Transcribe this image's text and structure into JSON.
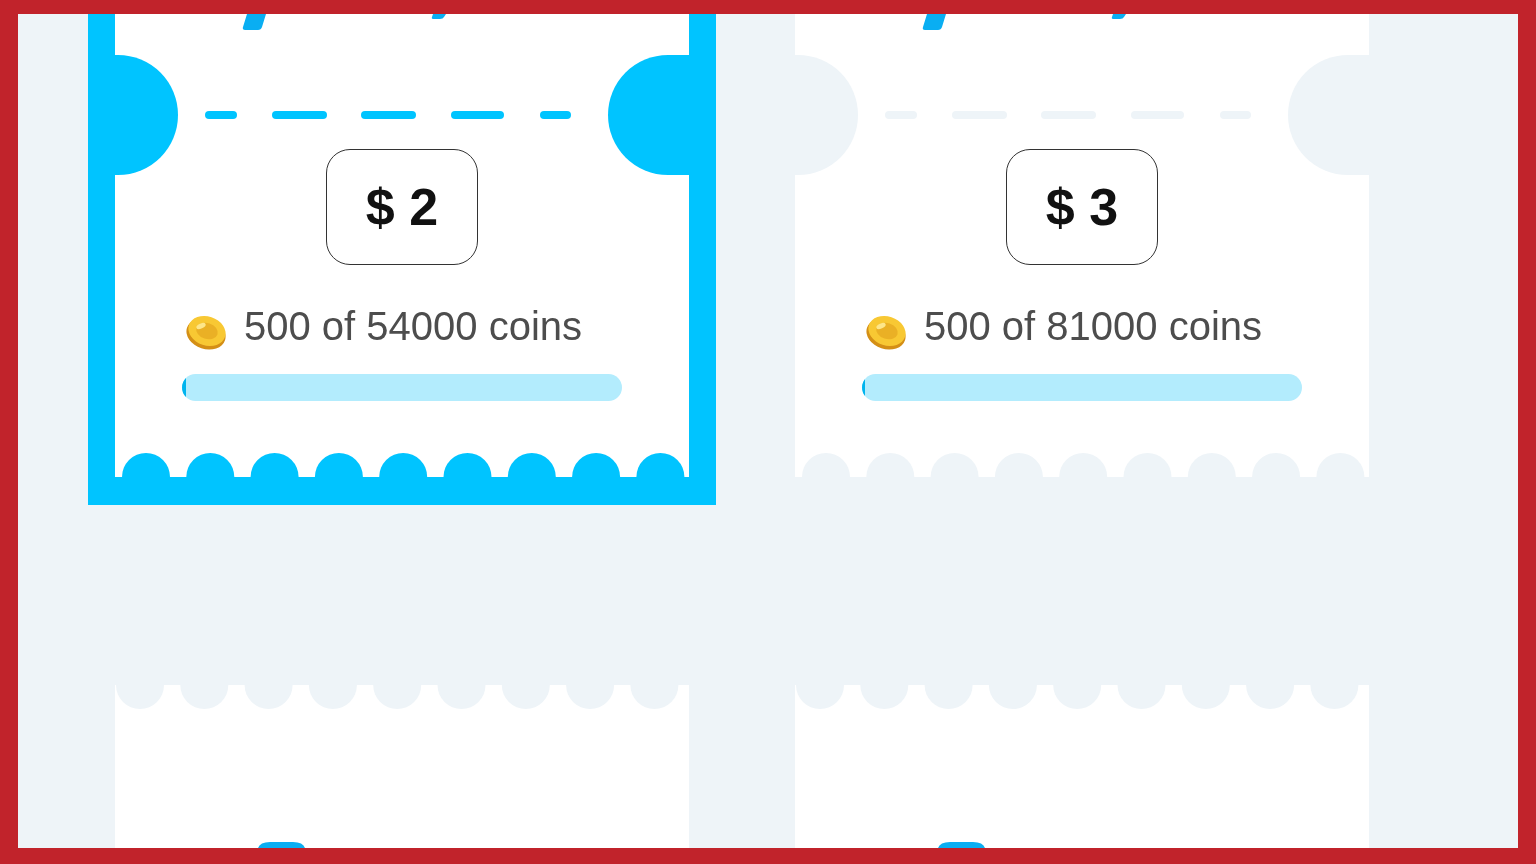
{
  "cards": [
    {
      "selected": true,
      "price": "$ 2",
      "progress_text": "500 of 54000 coins",
      "level": 0.009
    },
    {
      "selected": false,
      "price": "$ 3",
      "progress_text": "500 of 81000 coins",
      "level": 0.006
    }
  ],
  "next_cards": [
    {
      "selected": false
    },
    {
      "selected": false
    }
  ]
}
